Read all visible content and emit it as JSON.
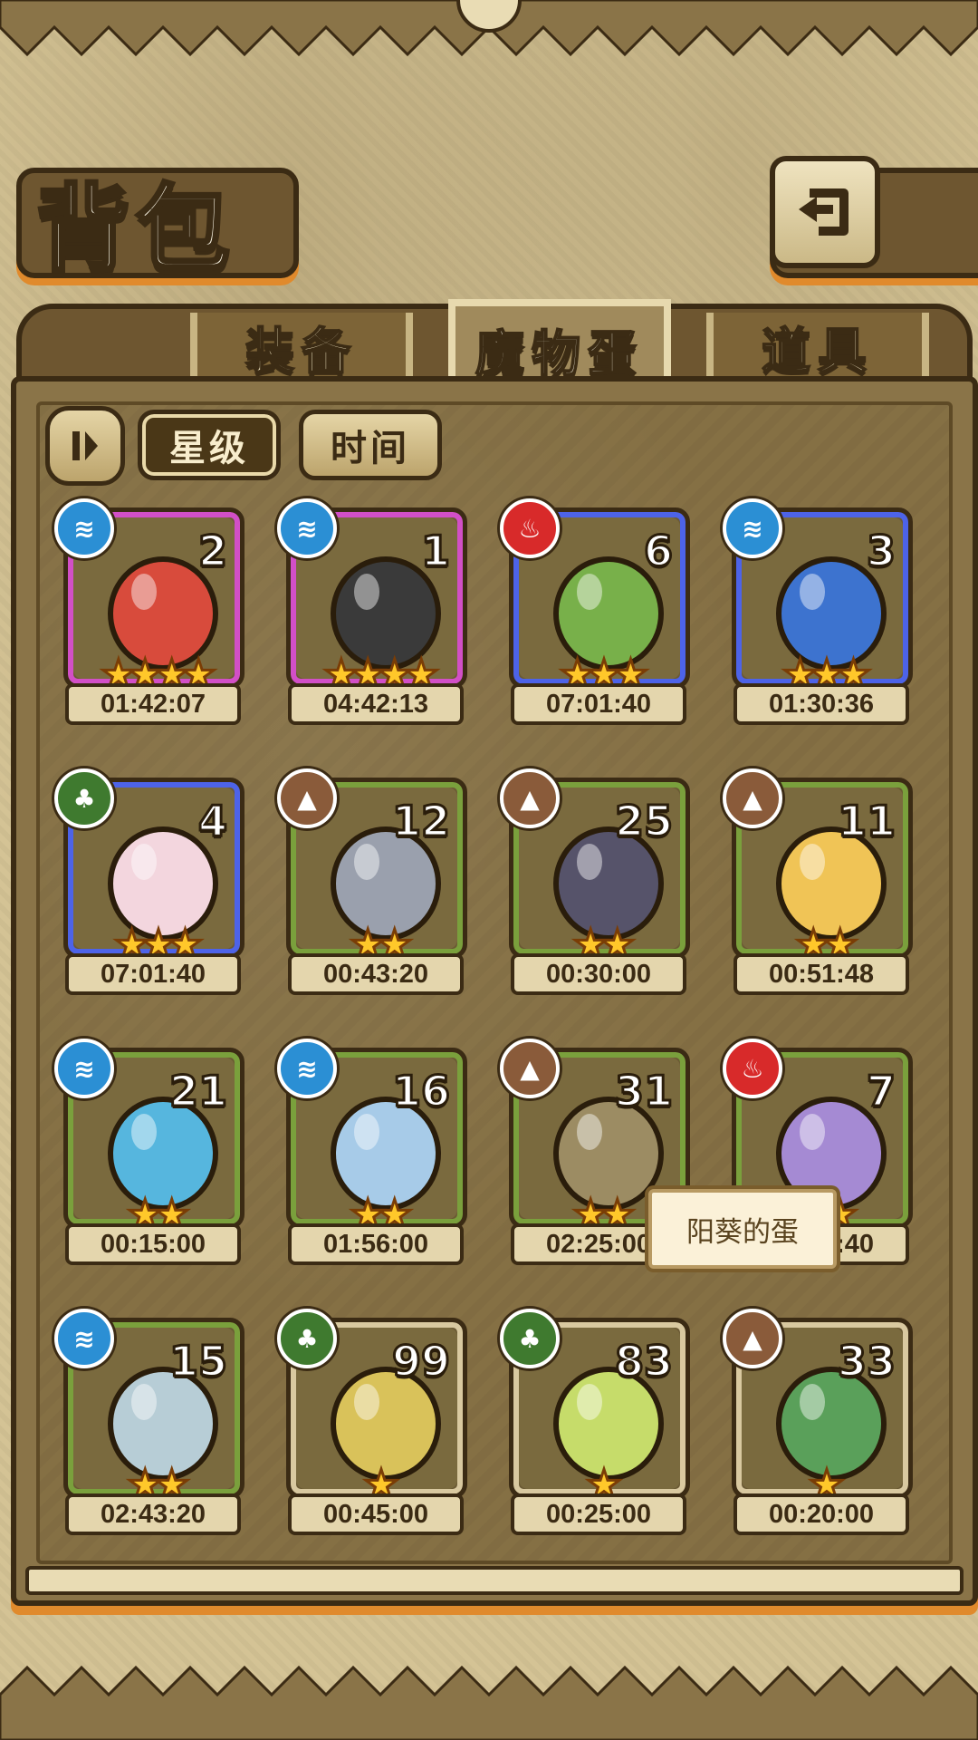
{
  "header": {
    "title": "背包",
    "back_icon": "return-arrow-icon"
  },
  "tabs": [
    {
      "label": "装备",
      "active": false
    },
    {
      "label": "魔物蛋",
      "active": true
    },
    {
      "label": "道具",
      "active": false
    }
  ],
  "sort": {
    "toggle_icon": "sort-toggle-icon",
    "options": [
      {
        "label": "星级",
        "selected": true
      },
      {
        "label": "时间",
        "selected": false
      }
    ]
  },
  "eggs": [
    {
      "element": "water",
      "count": "2",
      "stars": 4,
      "timer": "01:42:07",
      "rarity": "pink",
      "color": "#d84b3c"
    },
    {
      "element": "water",
      "count": "1",
      "stars": 4,
      "timer": "04:42:13",
      "rarity": "pink",
      "color": "#3a3a3a"
    },
    {
      "element": "fire",
      "count": "6",
      "stars": 3,
      "timer": "07:01:40",
      "rarity": "blue",
      "color": "#78b04a"
    },
    {
      "element": "water",
      "count": "3",
      "stars": 3,
      "timer": "01:30:36",
      "rarity": "blue",
      "color": "#3d73cf"
    },
    {
      "element": "grass",
      "count": "4",
      "stars": 3,
      "timer": "07:01:40",
      "rarity": "blue",
      "color": "#f3d6de"
    },
    {
      "element": "earth",
      "count": "12",
      "stars": 2,
      "timer": "00:43:20",
      "rarity": "green",
      "color": "#9aa0ad"
    },
    {
      "element": "earth",
      "count": "25",
      "stars": 2,
      "timer": "00:30:00",
      "rarity": "green",
      "color": "#56536a"
    },
    {
      "element": "earth",
      "count": "11",
      "stars": 2,
      "timer": "00:51:48",
      "rarity": "green",
      "color": "#f0c456"
    },
    {
      "element": "water",
      "count": "21",
      "stars": 2,
      "timer": "00:15:00",
      "rarity": "green",
      "color": "#56b6de"
    },
    {
      "element": "water",
      "count": "16",
      "stars": 2,
      "timer": "01:56:00",
      "rarity": "green",
      "color": "#a7cbe8"
    },
    {
      "element": "earth",
      "count": "31",
      "stars": 2,
      "timer": "02:25:00",
      "rarity": "green",
      "color": "#9c8c63"
    },
    {
      "element": "fire",
      "count": "7",
      "stars": 2,
      "timer": "00:46:40",
      "rarity": "green",
      "color": "#a58ad3"
    },
    {
      "element": "water",
      "count": "15",
      "stars": 2,
      "timer": "02:43:20",
      "rarity": "green",
      "color": "#b7cdd6"
    },
    {
      "element": "grass",
      "count": "99",
      "stars": 1,
      "timer": "00:45:00",
      "rarity": "tan",
      "color": "#d9c25a"
    },
    {
      "element": "grass",
      "count": "83",
      "stars": 1,
      "timer": "00:25:00",
      "rarity": "tan",
      "color": "#c6dc6a"
    },
    {
      "element": "earth",
      "count": "33",
      "stars": 1,
      "timer": "00:20:00",
      "rarity": "tan",
      "color": "#5aa05a"
    }
  ],
  "tooltip": {
    "text": "阳葵的蛋"
  },
  "colors": {
    "accent": "#e08a2c",
    "frame": "#3b2b14",
    "panel": "#857044"
  }
}
